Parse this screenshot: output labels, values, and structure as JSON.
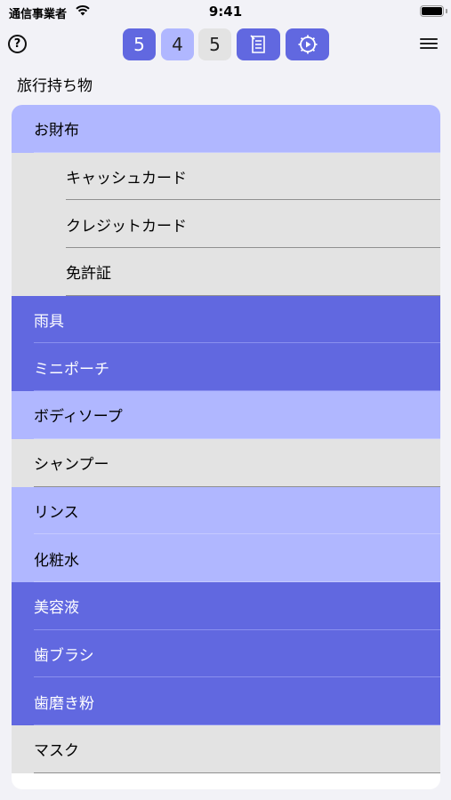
{
  "status": {
    "carrier": "通信事業者",
    "time": "9:41"
  },
  "toolbar": {
    "help": "?",
    "counts": [
      "5",
      "4",
      "5"
    ]
  },
  "list": {
    "title": "旅行持ち物",
    "items": [
      {
        "label": "お財布",
        "color": "light"
      },
      {
        "label": "キャッシュカード",
        "color": "gray",
        "sub": true
      },
      {
        "label": "クレジットカード",
        "color": "gray",
        "sub": true
      },
      {
        "label": "免許証",
        "color": "gray",
        "sub": true
      },
      {
        "label": "雨具",
        "color": "dark"
      },
      {
        "label": "ミニポーチ",
        "color": "dark"
      },
      {
        "label": "ボディソープ",
        "color": "light"
      },
      {
        "label": "シャンプー",
        "color": "gray"
      },
      {
        "label": "リンス",
        "color": "light"
      },
      {
        "label": "化粧水",
        "color": "light"
      },
      {
        "label": "美容液",
        "color": "dark"
      },
      {
        "label": "歯ブラシ",
        "color": "dark"
      },
      {
        "label": "歯磨き粉",
        "color": "dark"
      },
      {
        "label": "マスク",
        "color": "gray"
      }
    ]
  },
  "colors": {
    "light": "#b0b7ff",
    "dark": "#6168e0",
    "gray": "#e3e3e3"
  }
}
